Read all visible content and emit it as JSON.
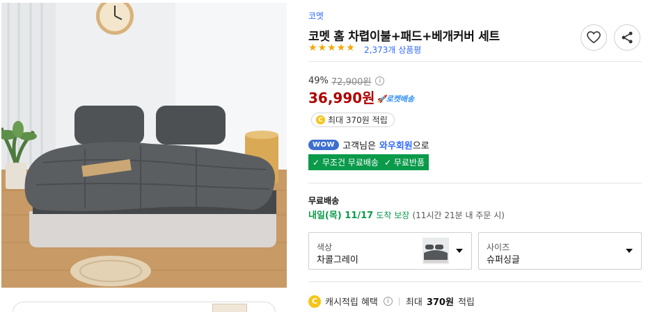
{
  "product": {
    "brand": "코멧",
    "title": "코멧 홈 차렵이불+패드+베개커버 세트",
    "rating_stars": 5,
    "review_count": "2,373개 상품평"
  },
  "actions": {
    "like_icon": "heart-icon",
    "share_icon": "share-icon"
  },
  "price": {
    "discount_rate": "49%",
    "original": "72,900원",
    "info_glyph": "i",
    "sale": "36,990원",
    "rocket_label": "🚀로켓배송"
  },
  "cash_badge": {
    "coin_glyph": "C",
    "text": "최대 370원 적립"
  },
  "wow": {
    "badge": "WOW",
    "prefix": "고객님은",
    "member": "와우회원",
    "suffix": "으로"
  },
  "benefits": {
    "free_shipping": "✓ 무조건 무료배송",
    "free_return": "✓ 무료반품"
  },
  "shipping": {
    "title": "무료배송",
    "date": "내일(목) 11/17",
    "guarantee": "도착 보장",
    "extra": "(11시간 21분 내 주문 시)"
  },
  "options": {
    "color_label": "색상",
    "color_value": "차콜그레이",
    "size_label": "사이즈",
    "size_value": "슈퍼싱글"
  },
  "cash_row": {
    "coin_glyph": "C",
    "label": "캐시적립 혜택",
    "info_glyph": "i",
    "max_prefix": "최대",
    "amount": "370원",
    "max_suffix": "적립"
  },
  "colors": {
    "accent_blue": "#346aff",
    "price_red": "#ae0000",
    "green": "#0a9a4a",
    "star": "#f5a700"
  }
}
